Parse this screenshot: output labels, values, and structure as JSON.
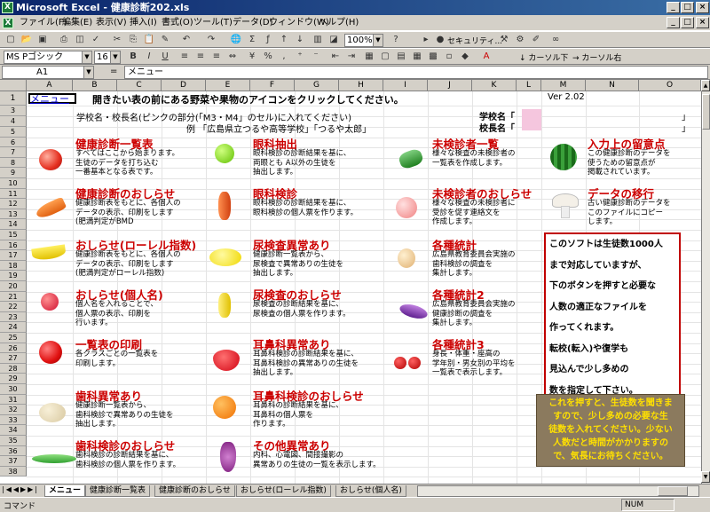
{
  "window": {
    "title": "Microsoft Excel - 健康診断202.xls"
  },
  "menus": [
    "ファイル(F)",
    "編集(E)",
    "表示(V)",
    "挿入(I)",
    "書式(O)",
    "ツール(T)",
    "データ(D)",
    "ウィンドウ(W)",
    "ヘルプ(H)"
  ],
  "toolbar": {
    "zoom": "100%",
    "security": "セキュリティ...",
    "font": "MS Pゴシック",
    "size": "16",
    "cursor_down": "カーソル下",
    "cursor_right": "カーソル右"
  },
  "formula": {
    "cell": "A1",
    "fx": "=",
    "value": "メニュー"
  },
  "columns": [
    "A",
    "B",
    "C",
    "D",
    "E",
    "F",
    "G",
    "H",
    "I",
    "J",
    "K",
    "L",
    "M",
    "N",
    "O"
  ],
  "rows": [
    "1",
    "3",
    "4",
    "5",
    "6",
    "7",
    "8",
    "9",
    "10",
    "11",
    "12",
    "13",
    "14",
    "15",
    "16",
    "17",
    "18",
    "19",
    "20",
    "21",
    "22",
    "23",
    "24",
    "25",
    "26",
    "27",
    "28",
    "29",
    "30",
    "31",
    "32",
    "33",
    "34",
    "35",
    "36",
    "37",
    "38"
  ],
  "sheet": {
    "a1": "メニュー",
    "header": "開きたい表の前にある野菜や果物のアイコンをクリックしてください。",
    "version": "Ver 2.02",
    "school_prompt": "学校名・校長名(ピンクの部分(「M3・M4」のセル)に入れてください)",
    "example": "例 「広島県立つるや高等学校」「つるや太郎」",
    "school_label": "学校名「",
    "principal_label": "校長名「",
    "close_bracket": "」"
  },
  "items": [
    {
      "title": "健康診断一覧表",
      "desc": [
        "すべてはここから始まります。",
        "生徒のデータを打ち込む",
        "一番基本となる表です。"
      ]
    },
    {
      "title": "健康診断のおしらせ",
      "desc": [
        "健康診断表をもとに、各個人の",
        "データの表示、印刷をします",
        "(肥満判定がBMD"
      ]
    },
    {
      "title": "おしらせ(ローレル指数)",
      "desc": [
        "健康診断表をもとに、各個人の",
        "データの表示、印刷をします",
        "(肥満判定がローレル指数)"
      ]
    },
    {
      "title": "おしらせ(個人名)",
      "desc": [
        "個人名を入れることで、",
        "個人票の表示、印刷を",
        "行います。"
      ]
    },
    {
      "title": "一覧表の印刷",
      "desc": [
        "各クラスごとの一覧表を",
        "印刷します。"
      ]
    },
    {
      "title": "歯科異常あり",
      "desc": [
        "健康診断一覧表から、",
        "歯科検診で異常ありの生徒を",
        "抽出します。"
      ]
    },
    {
      "title": "歯科検診のおしらせ",
      "desc": [
        "歯科検診の診断結果を基に、",
        "歯科検診の個人票を作ります。"
      ]
    },
    {
      "title": "眼科抽出",
      "desc": [
        "眼科検診の診断結果を基に、",
        "両眼とも A以外の生徒を",
        "抽出します。"
      ]
    },
    {
      "title": "眼科検診",
      "desc": [
        "眼科検診の診断結果を基に、",
        "眼科検診の個人票を作ります。"
      ]
    },
    {
      "title": "尿検査異常あり",
      "desc": [
        "健康診断一覧表から、",
        "尿検査で異常ありの生徒を",
        "抽出します。"
      ]
    },
    {
      "title": "尿検査のおしらせ",
      "desc": [
        "尿検査の診断結果を基に、",
        "尿検査の個人票を作ります。"
      ]
    },
    {
      "title": "耳鼻科異常あり",
      "desc": [
        "耳鼻科検診の診断結果を基に、",
        "耳鼻科検診の異常ありの生徒を",
        "抽出します。"
      ]
    },
    {
      "title": "耳鼻科検診のおしらせ",
      "desc": [
        "耳鼻科の診断結果を基に、",
        "耳鼻科の個人票を",
        "作ります。"
      ]
    },
    {
      "title": "その他異常あり",
      "desc": [
        "内科、心電図、間接撮影の",
        "異常ありの生徒の一覧を表示します。"
      ]
    },
    {
      "title": "未検診者一覧",
      "desc": [
        "様々な検査の未検診者の",
        "一覧表を作成します。"
      ]
    },
    {
      "title": "未検診者のおしらせ",
      "desc": [
        "様々な検査の未検診者に",
        "受診を促す連絡文を",
        "作成します。"
      ]
    },
    {
      "title": "各種統計",
      "desc": [
        "広島県教育委員会実施の",
        "歯科検診の調査を",
        "集計します。"
      ]
    },
    {
      "title": "各種統計2",
      "desc": [
        "広島県教育委員会実施の",
        "健康診断の調査を",
        "集計します。"
      ]
    },
    {
      "title": "各種統計3",
      "desc": [
        "身長・体重・座高の",
        "学年別・男女別の平均を",
        "一覧表で表示します。"
      ]
    },
    {
      "title": "入力上の留意点",
      "desc": [
        "この健康診断のデータを",
        "使うための留意点が",
        "掲載されています。"
      ]
    },
    {
      "title": "データの移行",
      "desc": [
        "古い健康診断のデータを",
        "このファイルにコピー",
        "します。"
      ]
    }
  ],
  "info_box": [
    "このソフトは生徒数1000人",
    "まで対応していますが、",
    "下のボタンを押すと必要な",
    "人数の適正なファイルを",
    "作ってくれます。",
    "転校(転入)や復学も",
    "見込んで少し多めの",
    "数を指定して下さい。"
  ],
  "notice": [
    "これを押すと、生徒数を聞きま",
    "すので、少し多めの必要な生",
    "徒数を入れてください。少ない",
    "人数だと時間がかかりますの",
    "で、気長にお待ちください。"
  ],
  "tabs": [
    "メニュー",
    "健康診断一覧表",
    "健康診断のおしらせ",
    "おしらせ(ローレル指数)",
    "おしらせ(個人名)"
  ],
  "status": {
    "mode": "コマンド",
    "num": "NUM"
  },
  "icons": [
    "tomato-icon",
    "carrot-icon",
    "banana-icon",
    "radish-icon",
    "apple-icon",
    "potato-icon",
    "cucumber-icon",
    "green-apple-icon",
    "chili-pepper-icon",
    "lemon-icon",
    "yellow-pepper-icon",
    "strawberry-icon",
    "orange-icon",
    "grapes-icon",
    "green-pepper-icon",
    "peach-icon",
    "onion-icon",
    "eggplant-icon",
    "cherry-icon",
    "watermelon-icon",
    "mushroom-icon"
  ],
  "colors": {
    "title_red": "#cc0000",
    "school_pink": "#f5c6de",
    "notice_bg": "#8b7a5e",
    "notice_text": "#ffe000"
  }
}
